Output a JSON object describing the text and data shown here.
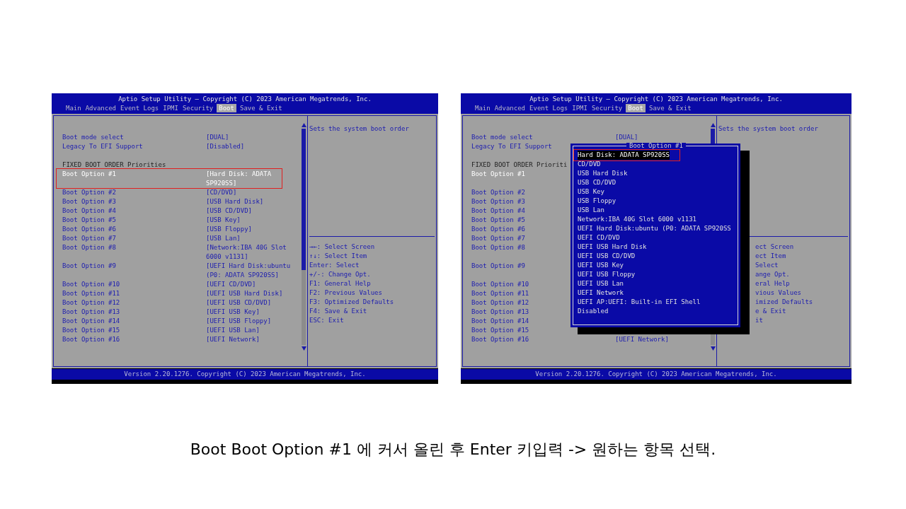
{
  "slide": {
    "screens": [
      {
        "title": "Aptio Setup Utility – Copyright (C) 2023 American Megatrends, Inc.",
        "tabs": [
          {
            "label": "Main",
            "selected": false
          },
          {
            "label": "Advanced",
            "selected": false
          },
          {
            "label": "Event Logs",
            "selected": false
          },
          {
            "label": "IPMI",
            "selected": false
          },
          {
            "label": "Security",
            "selected": false
          },
          {
            "label": "Boot",
            "selected": true
          },
          {
            "label": "Save & Exit",
            "selected": false
          }
        ],
        "settings": [
          {
            "kind": "setting",
            "label": "Boot mode select",
            "value": "[DUAL]",
            "selected": false,
            "highlighted": false
          },
          {
            "kind": "setting",
            "label": "Legacy To EFI Support",
            "value": "[Disabled]",
            "selected": false,
            "highlighted": false
          },
          {
            "kind": "heading",
            "label": "FIXED BOOT ORDER Priorities"
          },
          {
            "kind": "setting",
            "label": "Boot Option #1",
            "value": "[Hard Disk: ADATA SP920SS]",
            "selected": true,
            "highlighted": true
          },
          {
            "kind": "setting",
            "label": "Boot Option #2",
            "value": "[CD/DVD]",
            "selected": false,
            "highlighted": false
          },
          {
            "kind": "setting",
            "label": "Boot Option #3",
            "value": "[USB Hard Disk]",
            "selected": false,
            "highlighted": false
          },
          {
            "kind": "setting",
            "label": "Boot Option #4",
            "value": "[USB CD/DVD]",
            "selected": false,
            "highlighted": false
          },
          {
            "kind": "setting",
            "label": "Boot Option #5",
            "value": "[USB Key]",
            "selected": false,
            "highlighted": false
          },
          {
            "kind": "setting",
            "label": "Boot Option #6",
            "value": "[USB Floppy]",
            "selected": false,
            "highlighted": false
          },
          {
            "kind": "setting",
            "label": "Boot Option #7",
            "value": "[USB Lan]",
            "selected": false,
            "highlighted": false
          },
          {
            "kind": "setting",
            "label": "Boot Option #8",
            "value": "[Network:IBA 40G Slot 6000 v1131]",
            "selected": false,
            "highlighted": false
          },
          {
            "kind": "setting",
            "label": "Boot Option #9",
            "value": "[UEFI Hard Disk:ubuntu (P0: ADATA SP920SS]",
            "selected": false,
            "highlighted": false
          },
          {
            "kind": "setting",
            "label": "Boot Option #10",
            "value": "[UEFI CD/DVD]",
            "selected": false,
            "highlighted": false
          },
          {
            "kind": "setting",
            "label": "Boot Option #11",
            "value": "[UEFI USB Hard Disk]",
            "selected": false,
            "highlighted": false
          },
          {
            "kind": "setting",
            "label": "Boot Option #12",
            "value": "[UEFI USB CD/DVD]",
            "selected": false,
            "highlighted": false
          },
          {
            "kind": "setting",
            "label": "Boot Option #13",
            "value": "[UEFI USB Key]",
            "selected": false,
            "highlighted": false
          },
          {
            "kind": "setting",
            "label": "Boot Option #14",
            "value": "[UEFI USB Floppy]",
            "selected": false,
            "highlighted": false
          },
          {
            "kind": "setting",
            "label": "Boot Option #15",
            "value": "[UEFI USB Lan]",
            "selected": false,
            "highlighted": false
          },
          {
            "kind": "setting",
            "label": "Boot Option #16",
            "value": "[UEFI Network]",
            "selected": false,
            "highlighted": false
          }
        ],
        "description": "Sets the system boot order",
        "key_help": [
          "→←: Select Screen",
          "↑↓: Select Item",
          "Enter: Select",
          "+/-: Change Opt.",
          "F1: General Help",
          "F2: Previous Values",
          "F3: Optimized Defaults",
          "F4: Save & Exit",
          "ESC: Exit"
        ],
        "version": "Version 2.20.1276. Copyright (C) 2023 American Megatrends, Inc."
      },
      {
        "title": "Aptio Setup Utility – Copyright (C) 2023 American Megatrends, Inc.",
        "tabs": [
          {
            "label": "Main",
            "selected": false
          },
          {
            "label": "Advanced",
            "selected": false
          },
          {
            "label": "Event Logs",
            "selected": false
          },
          {
            "label": "IPMI",
            "selected": false
          },
          {
            "label": "Security",
            "selected": false
          },
          {
            "label": "Boot",
            "selected": true
          },
          {
            "label": "Save & Exit",
            "selected": false
          }
        ],
        "settings": [
          {
            "kind": "setting",
            "label": "Boot mode select",
            "value": "[DUAL]",
            "selected": false,
            "highlighted": false
          },
          {
            "kind": "setting",
            "label": "Legacy To EFI Support",
            "selected": false,
            "highlighted": false
          },
          {
            "kind": "heading",
            "label": "FIXED BOOT ORDER Prioriti"
          },
          {
            "kind": "setting",
            "label": "Boot Option #1",
            "selected": true,
            "highlighted": false,
            "tall": true
          },
          {
            "kind": "setting",
            "label": "Boot Option #2",
            "selected": false,
            "highlighted": false
          },
          {
            "kind": "setting",
            "label": "Boot Option #3",
            "selected": false,
            "highlighted": false
          },
          {
            "kind": "setting",
            "label": "Boot Option #4",
            "selected": false,
            "highlighted": false
          },
          {
            "kind": "setting",
            "label": "Boot Option #5",
            "selected": false,
            "highlighted": false
          },
          {
            "kind": "setting",
            "label": "Boot Option #6",
            "selected": false,
            "highlighted": false
          },
          {
            "kind": "setting",
            "label": "Boot Option #7",
            "selected": false,
            "highlighted": false
          },
          {
            "kind": "setting",
            "label": "Boot Option #8",
            "selected": false,
            "highlighted": false,
            "tall": true
          },
          {
            "kind": "setting",
            "label": "Boot Option #9",
            "selected": false,
            "highlighted": false,
            "tall": true
          },
          {
            "kind": "setting",
            "label": "Boot Option #10",
            "selected": false,
            "highlighted": false
          },
          {
            "kind": "setting",
            "label": "Boot Option #11",
            "selected": false,
            "highlighted": false
          },
          {
            "kind": "setting",
            "label": "Boot Option #12",
            "selected": false,
            "highlighted": false
          },
          {
            "kind": "setting",
            "label": "Boot Option #13",
            "selected": false,
            "highlighted": false
          },
          {
            "kind": "setting",
            "label": "Boot Option #14",
            "selected": false,
            "highlighted": false
          },
          {
            "kind": "setting",
            "label": "Boot Option #15",
            "selected": false,
            "highlighted": false
          },
          {
            "kind": "setting",
            "label": "Boot Option #16",
            "value": "[UEFI Network]",
            "selected": false,
            "highlighted": false
          }
        ],
        "description": "Sets the system boot order",
        "key_help": [
          "ect Screen",
          "ect Item",
          "Select",
          "ange Opt.",
          "eral Help",
          "vious Values",
          "imized Defaults",
          "e & Exit",
          "it"
        ],
        "version": "Version 2.20.1276. Copyright (C) 2023 American Megatrends, Inc.",
        "popup": {
          "title": "Boot Option #1",
          "options": [
            {
              "label": "Hard Disk: ADATA SP920SS",
              "selected": true,
              "highlighted": true
            },
            {
              "label": "CD/DVD",
              "selected": false,
              "highlighted": false
            },
            {
              "label": "USB Hard Disk",
              "selected": false,
              "highlighted": false
            },
            {
              "label": "USB CD/DVD",
              "selected": false,
              "highlighted": false
            },
            {
              "label": "USB Key",
              "selected": false,
              "highlighted": false
            },
            {
              "label": "USB Floppy",
              "selected": false,
              "highlighted": false
            },
            {
              "label": "USB Lan",
              "selected": false,
              "highlighted": false
            },
            {
              "label": "Network:IBA 40G Slot 6000 v1131",
              "selected": false,
              "highlighted": false
            },
            {
              "label": "UEFI Hard Disk:ubuntu (P0: ADATA SP920SS",
              "selected": false,
              "highlighted": false
            },
            {
              "label": "UEFI CD/DVD",
              "selected": false,
              "highlighted": false
            },
            {
              "label": "UEFI USB Hard Disk",
              "selected": false,
              "highlighted": false
            },
            {
              "label": "UEFI USB CD/DVD",
              "selected": false,
              "highlighted": false
            },
            {
              "label": "UEFI USB Key",
              "selected": false,
              "highlighted": false
            },
            {
              "label": "UEFI USB Floppy",
              "selected": false,
              "highlighted": false
            },
            {
              "label": "UEFI USB Lan",
              "selected": false,
              "highlighted": false
            },
            {
              "label": "UEFI Network",
              "selected": false,
              "highlighted": false
            },
            {
              "label": "UEFI AP:UEFI: Built-in EFI Shell",
              "selected": false,
              "highlighted": false
            },
            {
              "label": "Disabled",
              "selected": false,
              "highlighted": false
            }
          ]
        }
      }
    ],
    "caption": "Boot Boot Option #1 에 커서 올린 후 Enter 키입력 -> 원하는 항목 선택."
  }
}
